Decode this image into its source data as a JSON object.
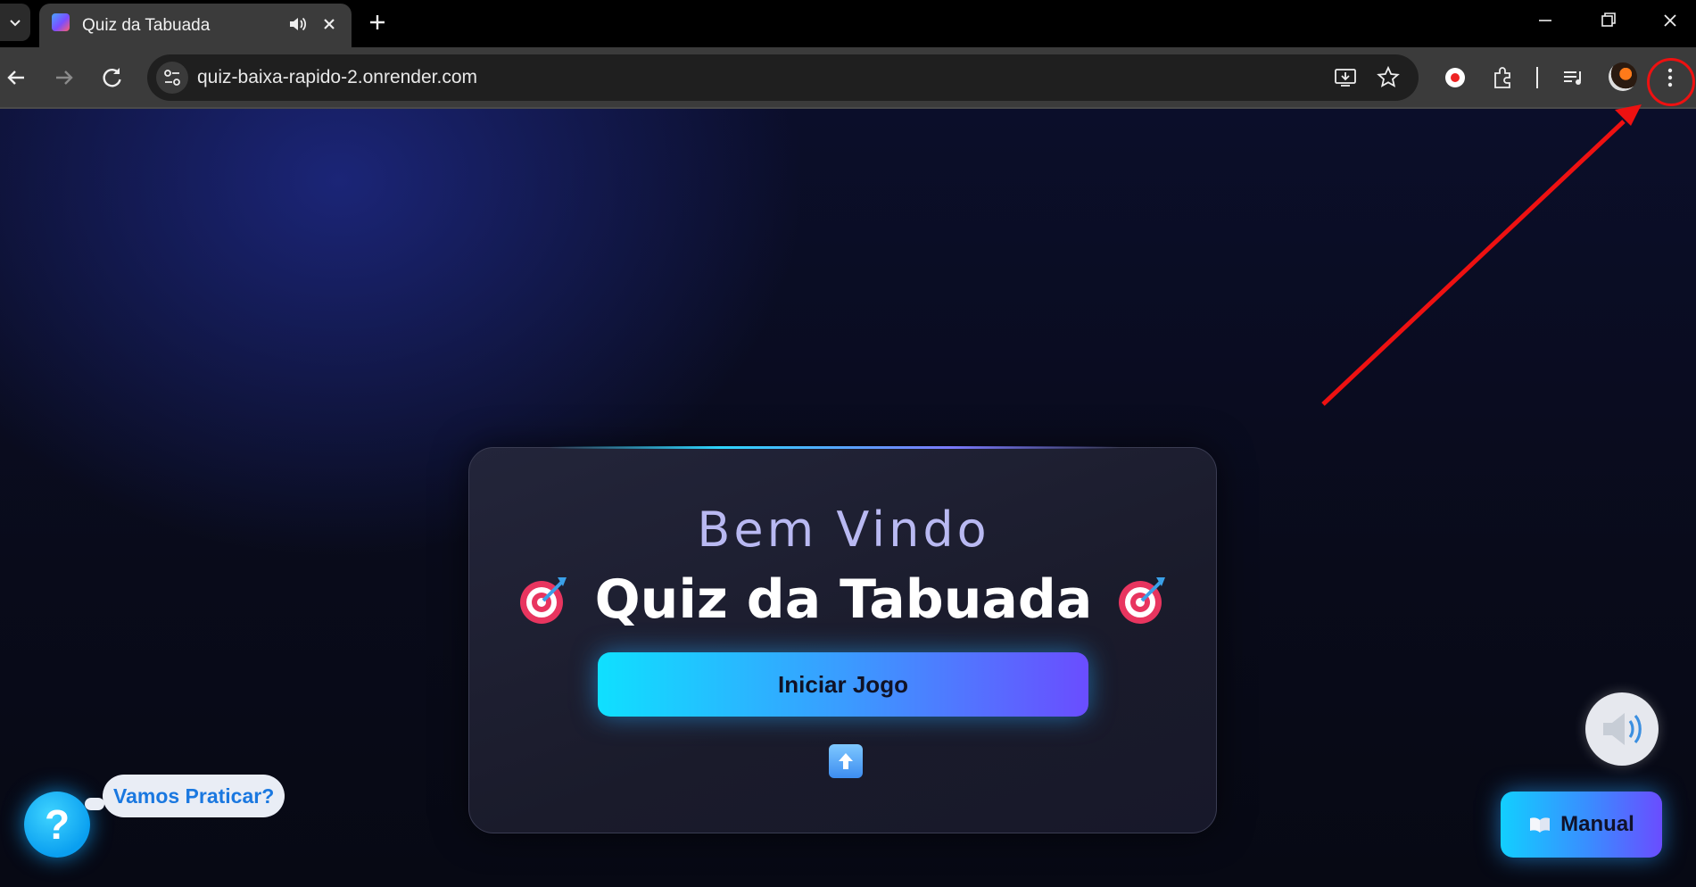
{
  "browser": {
    "tab_title": "Quiz da Tabuada",
    "url": "quiz-baixa-rapido-2.onrender.com",
    "new_tab_symbol": "+"
  },
  "card": {
    "welcome": "Bem Vindo",
    "title": "Quiz da Tabuada",
    "start_button": "Iniciar Jogo"
  },
  "help": {
    "symbol": "?",
    "bubble": "Vamos Praticar?"
  },
  "manual": {
    "label": "Manual"
  },
  "colors": {
    "accent_cyan": "#0fe0ff",
    "accent_violet": "#6a4dff",
    "annotation_red": "#e11"
  },
  "icons": [
    "tab-list-icon",
    "speaker-icon",
    "close-icon",
    "back-icon",
    "forward-icon",
    "reload-icon",
    "site-settings-icon",
    "install-icon",
    "star-icon",
    "record-icon",
    "extensions-icon",
    "media-controls-icon",
    "profile-avatar",
    "more-menu-icon",
    "target-icon",
    "upload-icon",
    "book-icon",
    "sound-icon"
  ]
}
